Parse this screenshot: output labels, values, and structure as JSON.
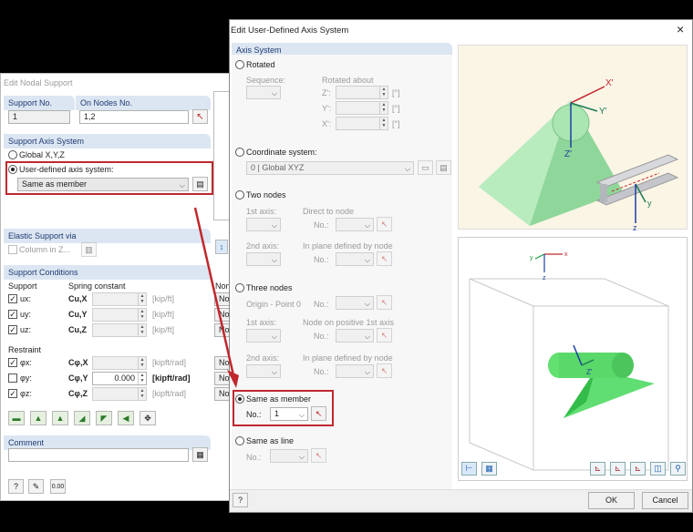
{
  "nodal": {
    "title": "Edit Nodal Support",
    "support_no_label": "Support No.",
    "support_no_value": "1",
    "on_nodes_label": "On Nodes No.",
    "on_nodes_value": "1,2",
    "axis_system_header": "Support Axis System",
    "global_label": "Global X,Y,Z",
    "user_defined_label": "User-defined axis system:",
    "user_defined_value": "Same as member",
    "elastic_header": "Elastic Support via",
    "column_label": "Column in Z...",
    "conditions_header": "Support Conditions",
    "col_support": "Support",
    "col_spring": "Spring constant",
    "col_nonlinearity": "Non",
    "supports": [
      {
        "label": "ux:",
        "const": "Cu,X",
        "value": "",
        "unit": "[kip/ft]",
        "checked": true,
        "nl": "Non"
      },
      {
        "label": "uy:",
        "const": "Cu,Y",
        "value": "",
        "unit": "[kip/ft]",
        "checked": true,
        "nl": "Non"
      },
      {
        "label": "uz:",
        "const": "Cu,Z",
        "value": "",
        "unit": "[kip/ft]",
        "checked": true,
        "nl": "Non"
      }
    ],
    "restraint_label": "Restraint",
    "restraints": [
      {
        "label": "φx:",
        "const": "Cφ,X",
        "value": "",
        "unit": "[kipft/rad]",
        "checked": true,
        "nl": "Non"
      },
      {
        "label": "φy:",
        "const": "Cφ,Y",
        "value": "0.000",
        "unit": "[kipft/rad]",
        "checked": false,
        "nl": "Non"
      },
      {
        "label": "φz:",
        "const": "Cφ,Z",
        "value": "",
        "unit": "[kipft/rad]",
        "checked": true,
        "nl": "Non"
      }
    ],
    "comment_header": "Comment",
    "comment_value": ""
  },
  "axis": {
    "title": "Edit User-Defined Axis System",
    "close": "×",
    "section_header": "Axis System",
    "rotated_label": "Rotated",
    "sequence_label": "Sequence:",
    "rotated_about_label": "Rotated about",
    "rot_z": "Z':",
    "rot_y": "Y':",
    "rot_x": "X':",
    "deg": "[°]",
    "coord_system_label": "Coordinate system:",
    "coord_system_value": "0 | Global XYZ",
    "two_nodes_label": "Two nodes",
    "first_axis": "1st axis:",
    "direct_to_node": "Direct to node",
    "no_label": "No.:",
    "second_axis": "2nd axis:",
    "in_plane_defined": "In plane defined by node",
    "three_nodes_label": "Three nodes",
    "origin_point": "Origin - Point 0",
    "node_positive": "Node on positive 1st axis",
    "same_member_label": "Same as member",
    "member_no_label": "No.:",
    "member_no_value": "1",
    "same_line_label": "Same as line",
    "line_no_label": "No.:",
    "ok_label": "OK",
    "cancel_label": "Cancel",
    "axes": {
      "x": "X'",
      "y": "Y'",
      "z": "Z'",
      "y_short": "y",
      "z_short": "z",
      "x_small": "x",
      "y_small": "y",
      "z_small": "z"
    }
  },
  "colors": {
    "accent_red": "#c0282d",
    "section_bg": "#dce6f2",
    "section_text": "#1f3b73"
  }
}
